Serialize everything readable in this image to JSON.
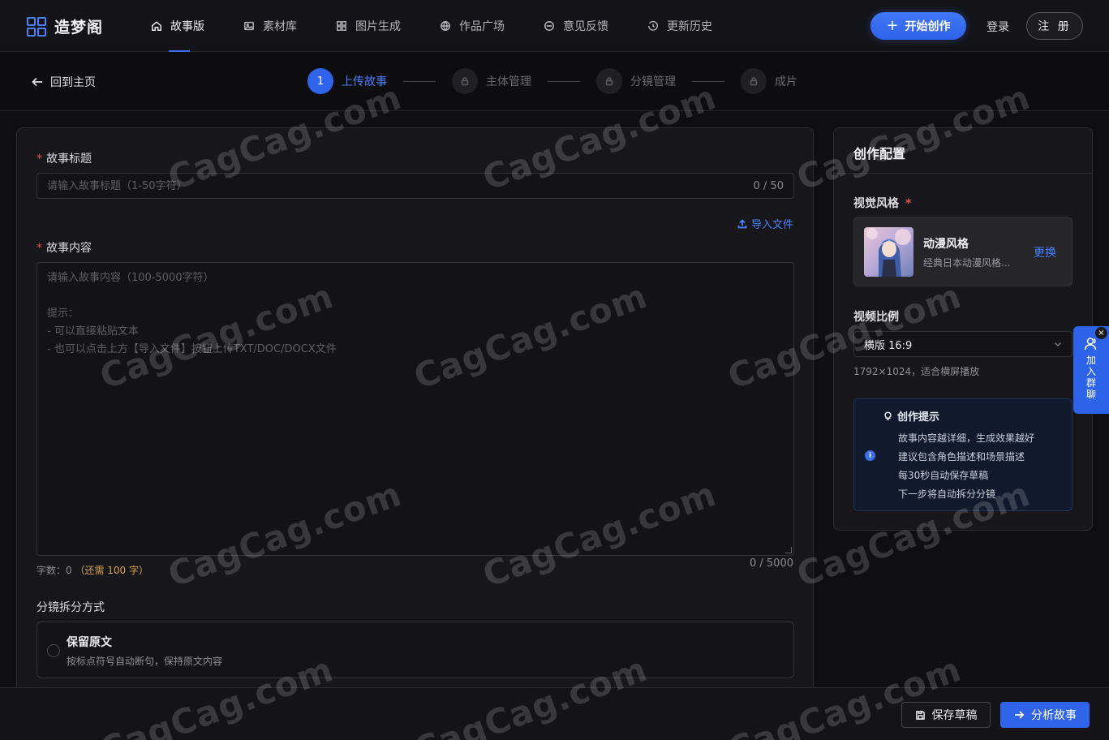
{
  "app": {
    "name": "造梦阁"
  },
  "nav": {
    "items": [
      {
        "label": "故事版",
        "icon": "home-icon",
        "active": true
      },
      {
        "label": "素材库",
        "icon": "image-icon"
      },
      {
        "label": "图片生成",
        "icon": "grid-icon"
      },
      {
        "label": "作品广场",
        "icon": "globe-icon"
      },
      {
        "label": "意见反馈",
        "icon": "message-icon"
      },
      {
        "label": "更新历史",
        "icon": "history-icon"
      }
    ],
    "start_label": "开始创作",
    "login_label": "登录",
    "register_label": "注 册"
  },
  "subbar": {
    "back_label": "回到主页",
    "steps": [
      {
        "number": "1",
        "label": "上传故事",
        "active": true
      },
      {
        "label": "主体管理",
        "locked": true
      },
      {
        "label": "分镜管理",
        "locked": true
      },
      {
        "label": "成片",
        "locked": true
      }
    ]
  },
  "form": {
    "title_label": "故事标题",
    "title_placeholder": "请输入故事标题（1-50字符）",
    "title_counter": "0 / 50",
    "import_label": "导入文件",
    "content_label": "故事内容",
    "content_placeholder": "请输入故事内容（100-5000字符）\n\n提示：\n- 可以直接粘贴文本\n- 也可以点击上方【导入文件】按钮上传TXT/DOC/DOCX文件",
    "word_count_prefix": "字数：0",
    "word_count_need": "（还需 100 字）",
    "content_counter": "0 / 5000",
    "split_label": "分镜拆分方式",
    "split_option": {
      "title": "保留原文",
      "desc": "按标点符号自动断句，保持原文内容"
    }
  },
  "config": {
    "title": "创作配置",
    "visual_style_label": "视觉风格",
    "style": {
      "name": "动漫风格",
      "desc": "经典日本动漫风格...",
      "change_label": "更换"
    },
    "ratio_label": "视频比例",
    "ratio_value": "横版 16:9",
    "ratio_hint": "1792×1024，适合横屏播放",
    "tips": {
      "title": "创作提示",
      "items": [
        "故事内容越详细，生成效果越好",
        "建议包含角色描述和场景描述",
        "每30秒自动保存草稿",
        "下一步将自动拆分分镜"
      ]
    }
  },
  "float": {
    "join_label": "加入群聊",
    "close_label": "×"
  },
  "footer": {
    "save_label": "保存草稿",
    "analyze_label": "分析故事"
  },
  "watermark": "CagCag.com",
  "colors": {
    "accent": "#2f63ea",
    "link": "#4a80ff",
    "required": "#e05252",
    "warning": "#d9a24a"
  }
}
